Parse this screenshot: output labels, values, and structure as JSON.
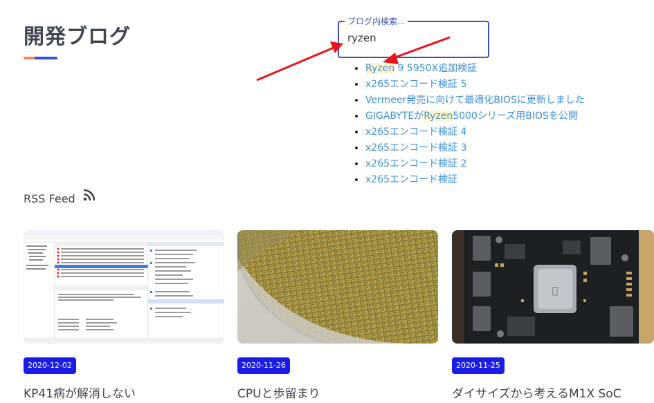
{
  "header": {
    "title": "開発ブログ"
  },
  "search": {
    "legend": "ブログ内検索...",
    "value": "ryzen"
  },
  "results": [
    {
      "pre": "",
      "hl": "Ryzen",
      "post": " 9 5950X追加検証"
    },
    {
      "pre": "x265エンコード検証 5",
      "hl": "",
      "post": ""
    },
    {
      "pre": "Vermeer発売に向けて最適化BIOSに更新しました",
      "hl": "",
      "post": ""
    },
    {
      "pre": "GIGABYTEが",
      "hl": "Ryzen",
      "post": "5000シリーズ用BIOSを公開"
    },
    {
      "pre": "x265エンコード検証 4",
      "hl": "",
      "post": ""
    },
    {
      "pre": "x265エンコード検証 3",
      "hl": "",
      "post": ""
    },
    {
      "pre": "x265エンコード検証 2",
      "hl": "",
      "post": ""
    },
    {
      "pre": "x265エンコード検証",
      "hl": "",
      "post": ""
    }
  ],
  "rss": {
    "label": "RSS Feed",
    "icon": "rss-icon"
  },
  "cards": [
    {
      "date": "2020-12-02",
      "title": "KP41病が解消しない",
      "image": "event-viewer-screenshot"
    },
    {
      "date": "2020-11-26",
      "title": "CPUと歩留まり",
      "image": "silicon-wafer-photo"
    },
    {
      "date": "2020-11-25",
      "title": "ダイサイズから考えるM1X SoC",
      "image": "m1-logic-board-photo"
    }
  ],
  "colors": {
    "accent": "#3f51b5",
    "badge": "#1a1de6",
    "link": "#3b8fd9",
    "arrow": "#e8141b",
    "underline_orange": "#f08a4b",
    "underline_blue": "#3450e8"
  }
}
